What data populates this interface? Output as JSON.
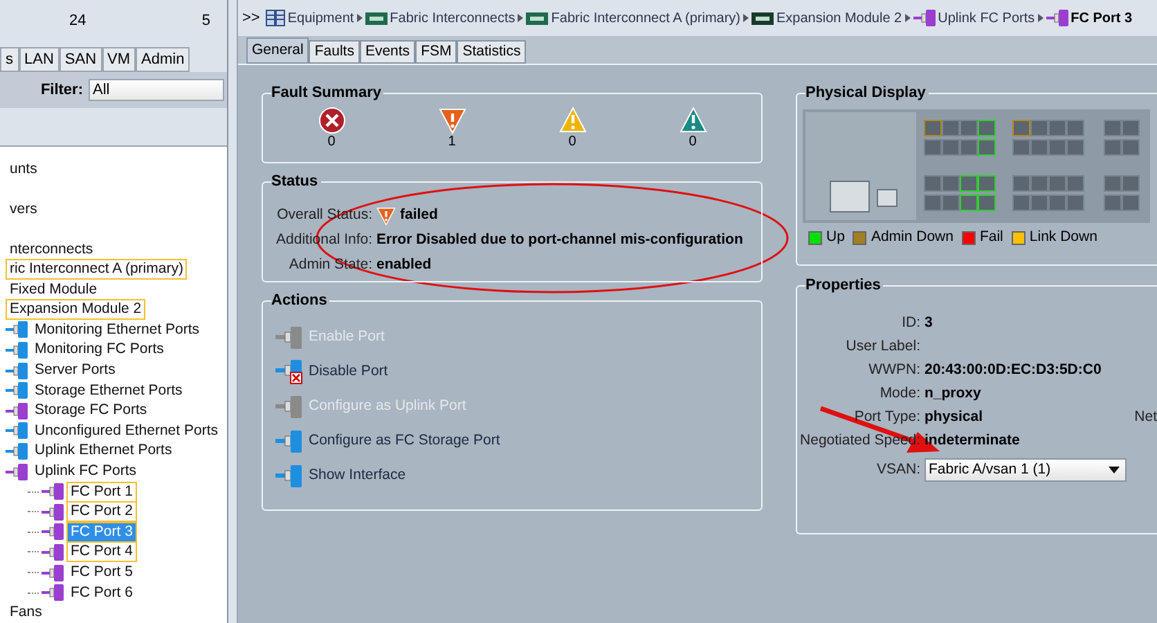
{
  "left_panel": {
    "counts": [
      "24",
      "5"
    ],
    "tabs": [
      {
        "label": "s",
        "selected": false
      },
      {
        "label": "LAN",
        "selected": false
      },
      {
        "label": "SAN",
        "selected": false
      },
      {
        "label": "VM",
        "selected": false
      },
      {
        "label": "Admin",
        "selected": false
      }
    ],
    "filter": {
      "label": "Filter:",
      "value": "All"
    },
    "tree": [
      {
        "label": "unts",
        "selected": false,
        "flagged": false
      },
      {
        "label": "vers",
        "selected": false,
        "flagged": false
      },
      {
        "label": "nterconnects",
        "selected": false,
        "flagged": false,
        "children": [
          {
            "label": "ric Interconnect A (primary)",
            "selected": false,
            "flagged": true,
            "children": [
              {
                "label": "Fixed Module",
                "selected": false,
                "flagged": false
              },
              {
                "label": "Expansion Module 2",
                "selected": false,
                "flagged": true,
                "children": [
                  {
                    "label": "Monitoring Ethernet Ports",
                    "kind": "eth",
                    "selected": false,
                    "flagged": false
                  },
                  {
                    "label": "Monitoring FC Ports",
                    "kind": "eth",
                    "selected": false,
                    "flagged": false
                  },
                  {
                    "label": "Server Ports",
                    "kind": "eth",
                    "selected": false,
                    "flagged": false
                  },
                  {
                    "label": "Storage Ethernet Ports",
                    "kind": "eth",
                    "selected": false,
                    "flagged": false
                  },
                  {
                    "label": "Storage FC Ports",
                    "kind": "fc",
                    "selected": false,
                    "flagged": false
                  },
                  {
                    "label": "Unconfigured Ethernet Ports",
                    "kind": "eth",
                    "selected": false,
                    "flagged": false
                  },
                  {
                    "label": "Uplink Ethernet Ports",
                    "kind": "eth",
                    "selected": false,
                    "flagged": false
                  },
                  {
                    "label": "Uplink FC Ports",
                    "kind": "fc",
                    "selected": false,
                    "flagged": false,
                    "children": [
                      {
                        "label": "FC Port 1",
                        "kind": "fc",
                        "selected": false,
                        "flagged": true
                      },
                      {
                        "label": "FC Port 2",
                        "kind": "fc",
                        "selected": false,
                        "flagged": true
                      },
                      {
                        "label": "FC Port 3",
                        "kind": "fc",
                        "selected": true,
                        "flagged": true
                      },
                      {
                        "label": "FC Port 4",
                        "kind": "fc",
                        "selected": false,
                        "flagged": true
                      },
                      {
                        "label": "FC Port 5",
                        "kind": "fc",
                        "selected": false,
                        "flagged": false
                      },
                      {
                        "label": "FC Port 6",
                        "kind": "fc",
                        "selected": false,
                        "flagged": false
                      }
                    ]
                  }
                ]
              }
            ]
          }
        ]
      },
      {
        "label": "Fans",
        "selected": false,
        "flagged": false
      }
    ]
  },
  "breadcrumb": {
    "prefix": ">>",
    "items": [
      {
        "label": "Equipment",
        "kind": "rack"
      },
      {
        "label": "Fabric Interconnects",
        "kind": "chassis"
      },
      {
        "label": "Fabric Interconnect A (primary)",
        "kind": "chassis"
      },
      {
        "label": "Expansion Module 2",
        "kind": "module"
      },
      {
        "label": "Uplink FC Ports",
        "kind": "fc"
      },
      {
        "label": "FC Port 3",
        "kind": "fc"
      }
    ]
  },
  "tabs": [
    {
      "label": "General",
      "selected": true
    },
    {
      "label": "Faults",
      "selected": false
    },
    {
      "label": "Events",
      "selected": false
    },
    {
      "label": "FSM",
      "selected": false
    },
    {
      "label": "Statistics",
      "selected": false
    }
  ],
  "fault_summary": {
    "title": "Fault Summary",
    "items": [
      {
        "kind": "critical",
        "count": "0"
      },
      {
        "kind": "major",
        "count": "1"
      },
      {
        "kind": "minor",
        "count": "0"
      },
      {
        "kind": "warning",
        "count": "0"
      }
    ]
  },
  "status": {
    "title": "Status",
    "rows": [
      {
        "label": "Overall Status:",
        "value": "failed",
        "kind": "major"
      },
      {
        "label": "Additional Info:",
        "value": "Error Disabled due to port-channel mis-configuration"
      },
      {
        "label": "Admin State:",
        "value": "enabled"
      }
    ]
  },
  "actions": {
    "title": "Actions",
    "items": [
      {
        "label": "Enable Port",
        "kind": "port",
        "disabled": true
      },
      {
        "label": "Disable Port",
        "kind": "disable",
        "disabled": false
      },
      {
        "label": "Configure as Uplink Port",
        "kind": "port",
        "disabled": true
      },
      {
        "label": "Configure as FC Storage Port",
        "kind": "port",
        "disabled": false
      },
      {
        "label": "Show Interface",
        "kind": "port",
        "disabled": false
      }
    ]
  },
  "physical_display": {
    "title": "Physical Display",
    "legend": [
      {
        "label": "Up",
        "color": "#00e000"
      },
      {
        "label": "Admin Down",
        "color": "#a08020"
      },
      {
        "label": "Fail",
        "color": "#ff0000"
      },
      {
        "label": "Link Down",
        "color": "#ffc000"
      }
    ]
  },
  "properties": {
    "title": "Properties",
    "rows": [
      {
        "label": "ID:",
        "value": "3"
      },
      {
        "label": "User Label:"
      },
      {
        "label": "WWPN:",
        "value": "20:43:00:0D:EC:D3:5D:C0"
      },
      {
        "label": "Mode:",
        "value": "n_proxy"
      },
      {
        "label": "Port Type:",
        "value": "physical",
        "extra": "Net"
      },
      {
        "label": "Negotiated Speed:",
        "value": "indeterminate"
      }
    ],
    "vsan": {
      "label": "VSAN:",
      "value": "Fabric A/vsan 1 (1)"
    }
  }
}
